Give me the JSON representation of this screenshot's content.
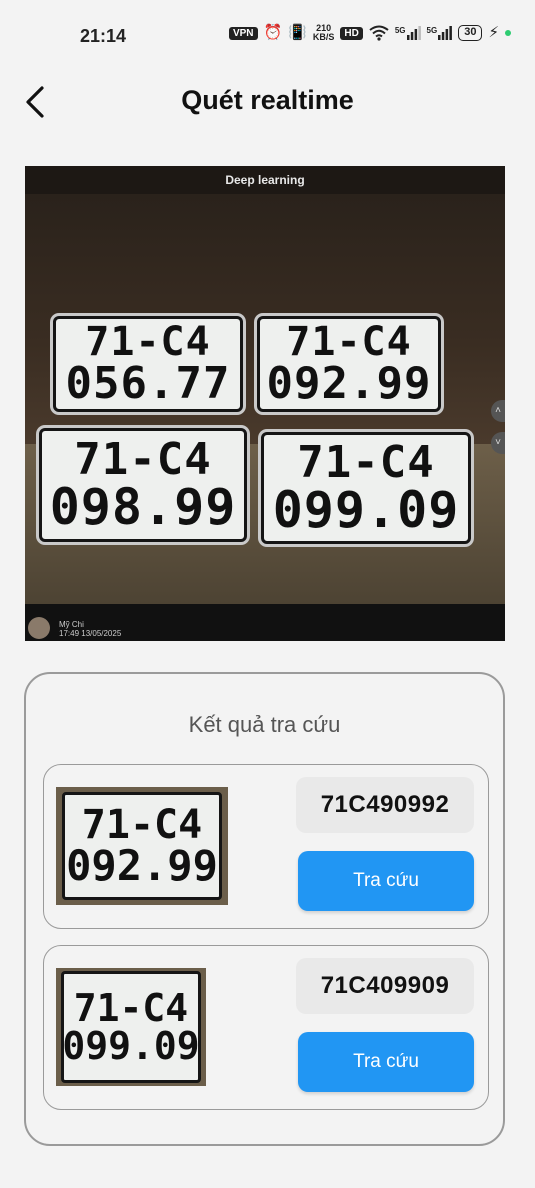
{
  "status_bar": {
    "time": "21:14",
    "vpn": "VPN",
    "speed_value": "210",
    "speed_unit": "KB/S",
    "hd": "HD",
    "net1": "5G",
    "net2": "5G",
    "battery": "30"
  },
  "header": {
    "title": "Quét realtime",
    "back_icon": "chevron-left-icon"
  },
  "camera": {
    "caption": "Deep learning",
    "user_name": "Mỹ Chi",
    "user_stamp": "17:49 13/05/2025",
    "plates": [
      {
        "line1": "71-C4",
        "line2": "056.77"
      },
      {
        "line1": "71-C4",
        "line2": "092.99"
      },
      {
        "line1": "71-C4",
        "line2": "098.99"
      },
      {
        "line1": "71-C4",
        "line2": "099.09"
      }
    ]
  },
  "results": {
    "title": "Kết quả tra cứu",
    "items": [
      {
        "thumb_line1": "71-C4",
        "thumb_line2": "092.99",
        "plate_number": "71C490992",
        "button_label": "Tra cứu"
      },
      {
        "thumb_line1": "71-C4",
        "thumb_line2": "099.09",
        "plate_number": "71C409909",
        "button_label": "Tra cứu"
      }
    ]
  },
  "colors": {
    "accent": "#2196f3",
    "background": "#f3f3f3",
    "border": "#9a9a9a"
  }
}
